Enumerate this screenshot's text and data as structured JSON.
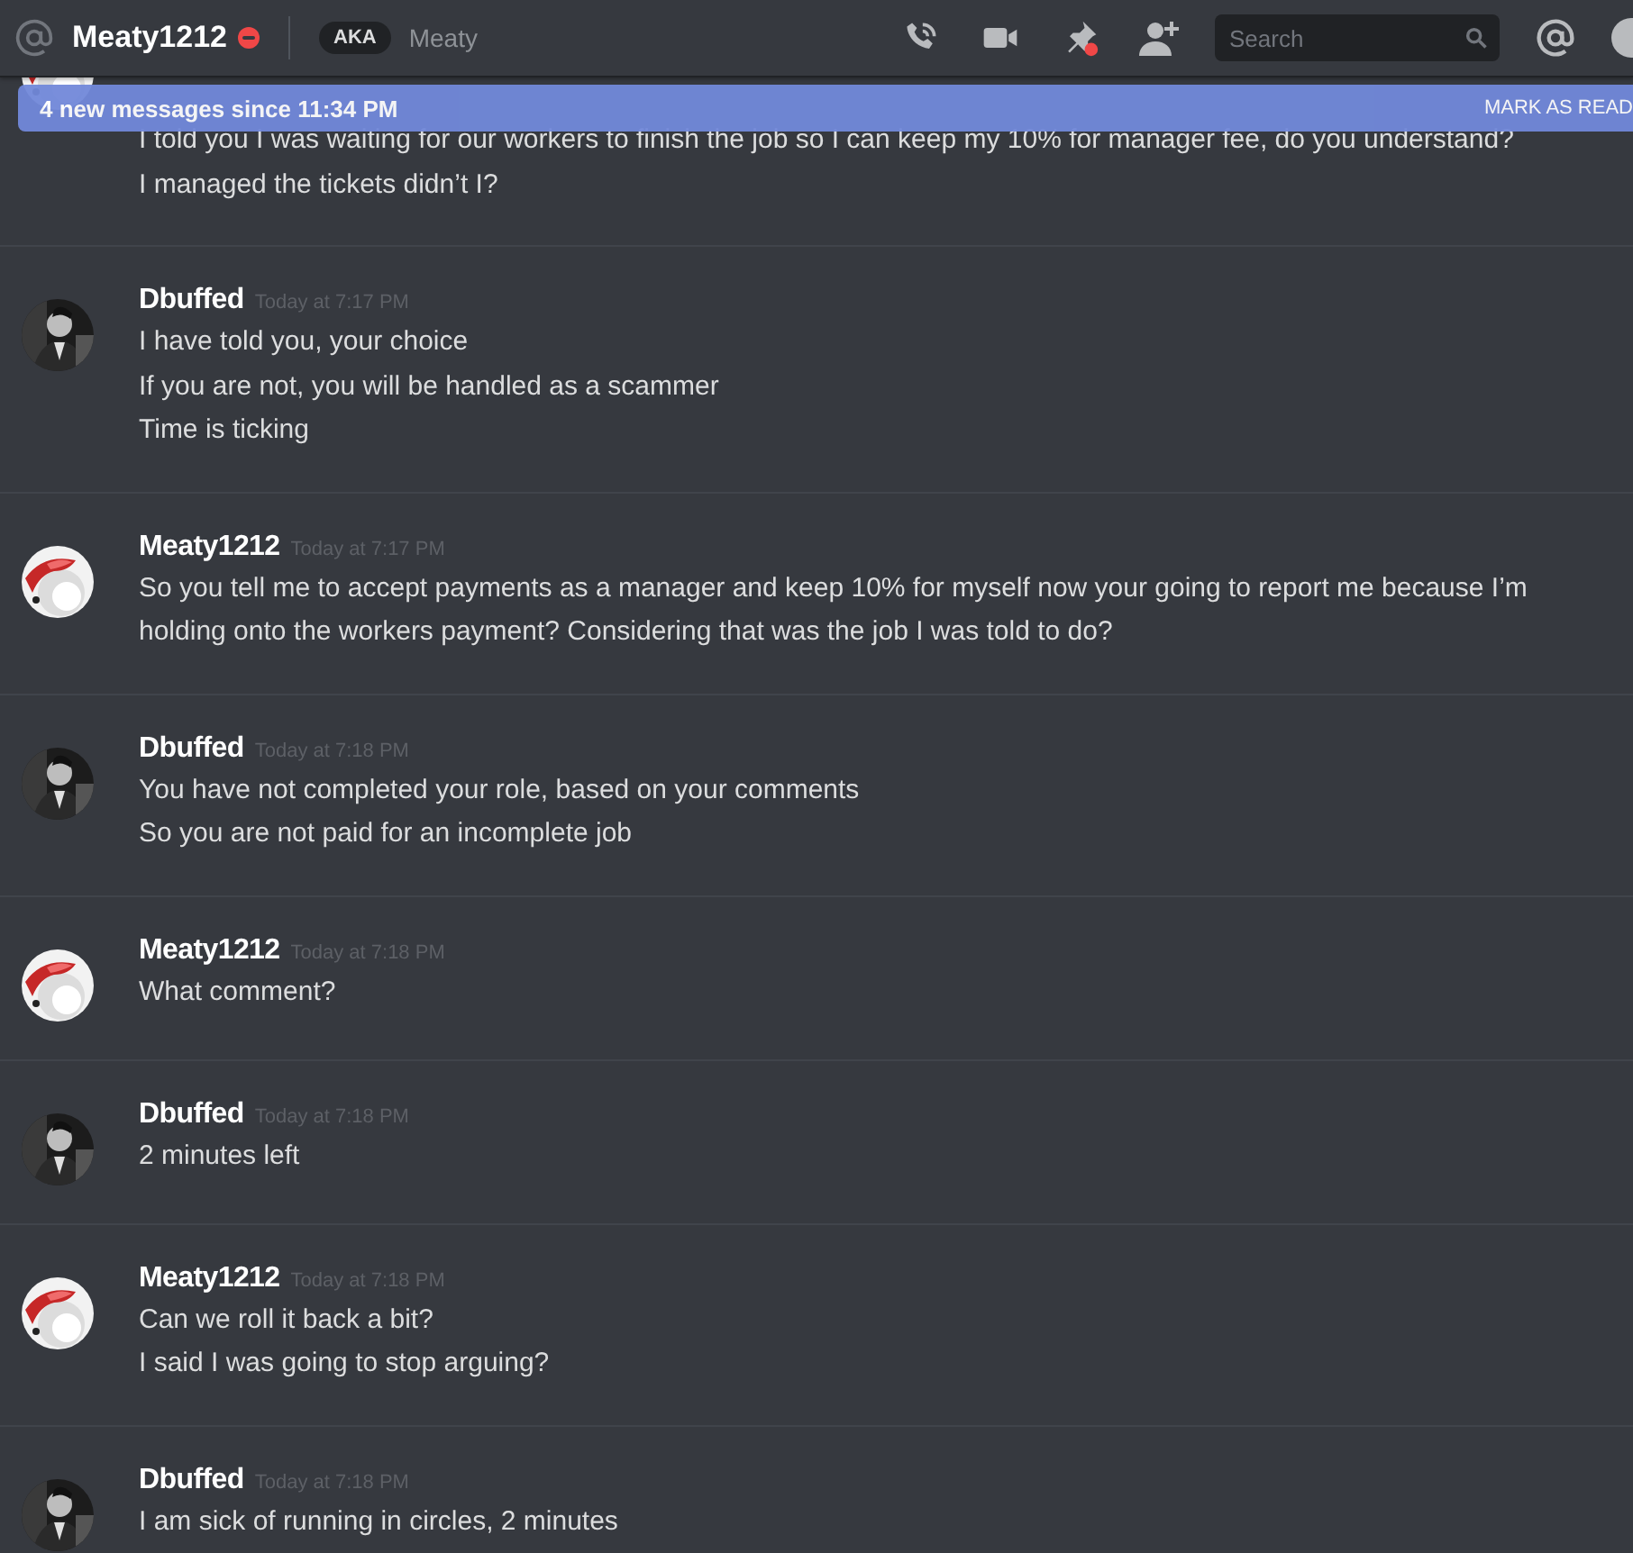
{
  "header": {
    "channel_name": "Meaty1212",
    "aka_badge": "AKA",
    "aka_name": "Meaty",
    "search": {
      "placeholder": "Search"
    }
  },
  "banner": {
    "text": "4 new messages since 11:34 PM",
    "action": "MARK AS READ"
  },
  "messages": [
    {
      "kind": "continued",
      "lines": [
        "I told you I was waiting for our workers to finish the job so I can keep my 10% for manager fee, do you understand?",
        "I managed the tickets didn’t I?"
      ]
    },
    {
      "kind": "group",
      "author": "Dbuffed",
      "time": "Today at 7:17 PM",
      "lines": [
        "I have told you, your choice",
        "If you are not, you will be handled as a scammer",
        "Time is ticking"
      ]
    },
    {
      "kind": "group",
      "author": "Meaty1212",
      "time": "Today at 7:17 PM",
      "lines": [
        "So you tell me to accept payments as a manager and keep 10% for myself now your going to report me because I’m holding onto the workers payment? Considering that was the job I was told to do?"
      ]
    },
    {
      "kind": "group",
      "author": "Dbuffed",
      "time": "Today at 7:18 PM",
      "lines": [
        "You have not completed your role, based on your comments",
        "So you are not paid for an incomplete job"
      ]
    },
    {
      "kind": "group",
      "author": "Meaty1212",
      "time": "Today at 7:18 PM",
      "lines": [
        "What comment?"
      ]
    },
    {
      "kind": "group",
      "author": "Dbuffed",
      "time": "Today at 7:18 PM",
      "lines": [
        "2 minutes left"
      ]
    },
    {
      "kind": "group",
      "author": "Meaty1212",
      "time": "Today at 7:18 PM",
      "lines": [
        "Can we roll it back a bit?",
        "I said I was going to stop arguing?"
      ]
    },
    {
      "kind": "group",
      "author": "Dbuffed",
      "time": "Today at 7:18 PM",
      "lines": [
        "I am sick of running in circles, 2 minutes"
      ]
    }
  ]
}
